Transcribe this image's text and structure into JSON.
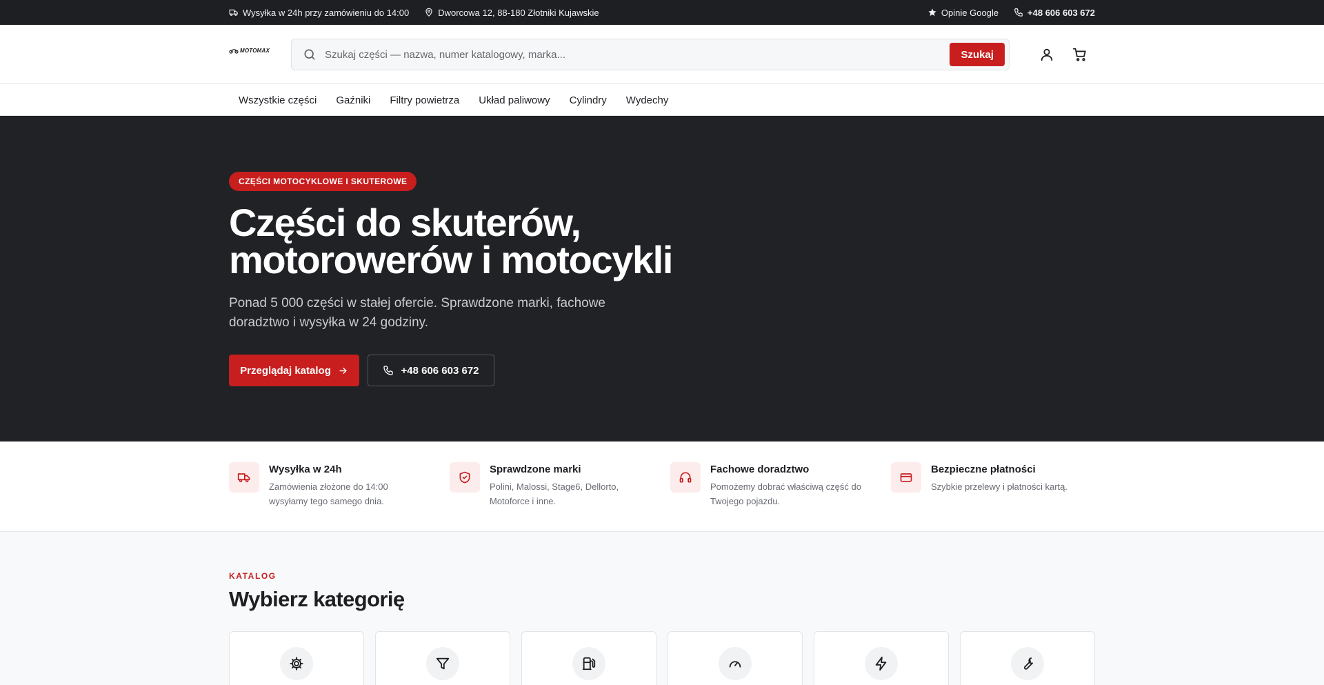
{
  "topbar": {
    "shipping": "Wysyłka w 24h przy zamówieniu do 14:00",
    "address": "Dworcowa 12, 88-180 Złotniki Kujawskie",
    "reviews": "Opinie Google",
    "phone": "+48 606 603 672"
  },
  "header": {
    "logo_text": "MOTOMAX",
    "search_placeholder": "Szukaj części — nazwa, numer katalogowy, marka...",
    "search_button": "Szukaj"
  },
  "nav": {
    "items": [
      "Wszystkie części",
      "Gaźniki",
      "Filtry powietrza",
      "Układ paliwowy",
      "Cylindry",
      "Wydechy"
    ]
  },
  "hero": {
    "badge": "CZĘŚCI MOTOCYKLOWE I SKUTEROWE",
    "title_line1": "Części do skuterów,",
    "title_line2": "motorowerów i motocykli",
    "subtitle": "Ponad 5 000 części w stałej ofercie. Sprawdzone marki, fachowe doradztwo i wysyłka w 24 godziny.",
    "cta_primary": "Przeglądaj katalog",
    "cta_phone": "+48 606 603 672"
  },
  "features": [
    {
      "icon": "truck-icon",
      "title": "Wysyłka w 24h",
      "desc": "Zamówienia złożone do 14:00 wysyłamy tego samego dnia."
    },
    {
      "icon": "shield-check-icon",
      "title": "Sprawdzone marki",
      "desc": "Polini, Malossi, Stage6, Dellorto, Motoforce i inne."
    },
    {
      "icon": "headphones-icon",
      "title": "Fachowe doradztwo",
      "desc": "Pomożemy dobrać właściwą część do Twojego pojazdu."
    },
    {
      "icon": "credit-card-icon",
      "title": "Bezpieczne płatności",
      "desc": "Szybkie przelewy i płatności kartą."
    }
  ],
  "catalog": {
    "kicker": "KATALOG",
    "title": "Wybierz kategorię",
    "cards": [
      {
        "icon": "gear-icon"
      },
      {
        "icon": "filter-icon"
      },
      {
        "icon": "fuel-icon"
      },
      {
        "icon": "gauge-icon"
      },
      {
        "icon": "lightning-icon"
      },
      {
        "icon": "wrench-icon"
      }
    ]
  },
  "colors": {
    "accent": "#c81e1e",
    "dark": "#212226",
    "topbar": "#1e1f23",
    "soft_red": "#fdecec",
    "catalog_bg": "#f8f9fa"
  }
}
